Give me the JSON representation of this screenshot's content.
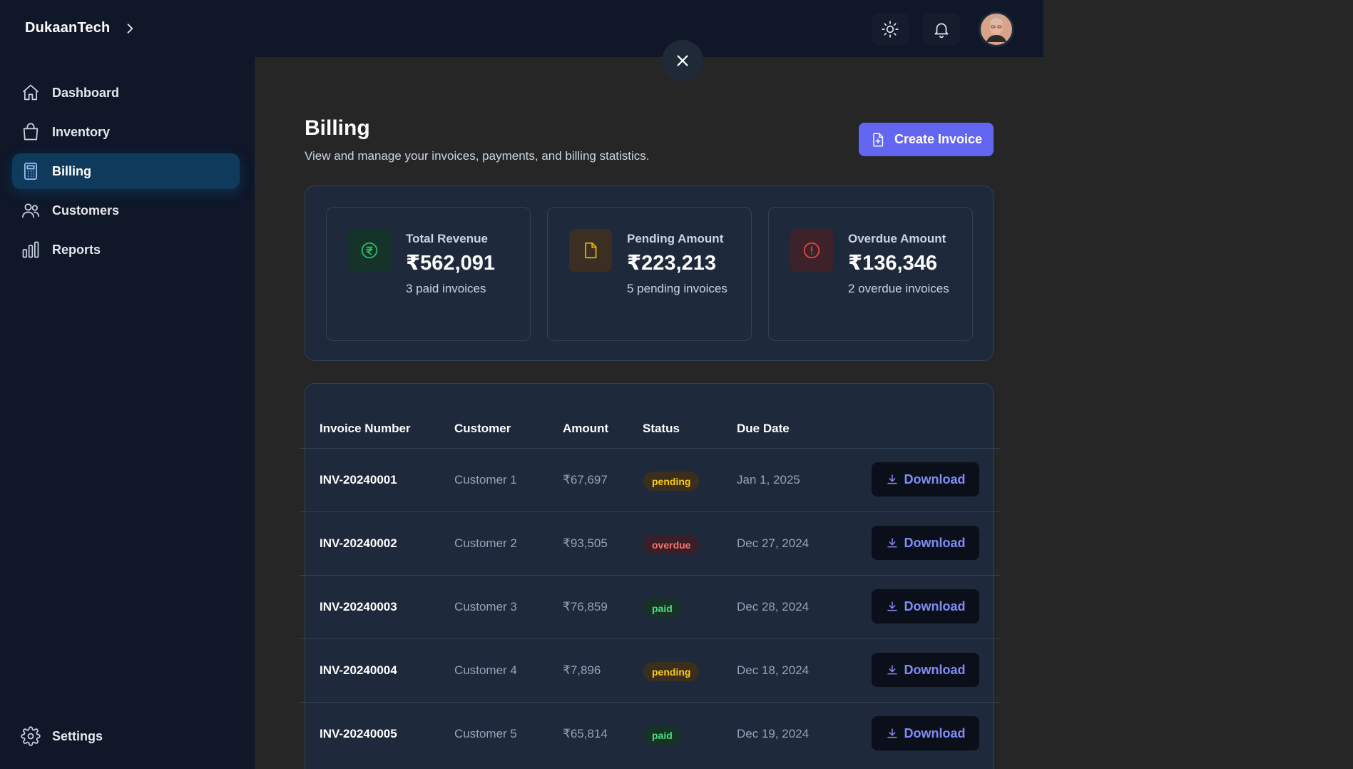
{
  "app": {
    "brand": "DukaanTech"
  },
  "sidebar": {
    "items": [
      {
        "label": "Dashboard",
        "icon": "home-icon"
      },
      {
        "label": "Inventory",
        "icon": "shopping-bag-icon"
      },
      {
        "label": "Billing",
        "icon": "calculator-icon",
        "active": true
      },
      {
        "label": "Customers",
        "icon": "users-icon"
      },
      {
        "label": "Reports",
        "icon": "bar-chart-icon"
      }
    ],
    "settings_label": "Settings"
  },
  "header": {
    "title": "Billing",
    "subtitle": "View and manage your invoices, payments, and billing statistics.",
    "create_label": "Create Invoice"
  },
  "stats": [
    {
      "label": "Total Revenue",
      "value": "₹562,091",
      "sub": "3 paid invoices",
      "icon": "rupee-circle-icon",
      "color": "#22c55e"
    },
    {
      "label": "Pending Amount",
      "value": "₹223,213",
      "sub": "5 pending invoices",
      "icon": "document-icon",
      "color": "#eab308"
    },
    {
      "label": "Overdue Amount",
      "value": "₹136,346",
      "sub": "2 overdue invoices",
      "icon": "alert-circle-icon",
      "color": "#ef4444"
    }
  ],
  "table": {
    "columns": [
      "Invoice Number",
      "Customer",
      "Amount",
      "Status",
      "Due Date"
    ],
    "download_label": "Download",
    "rows": [
      {
        "invoice": "INV-20240001",
        "customer": "Customer 1",
        "amount": "₹67,697",
        "status": "pending",
        "due": "Jan 1, 2025"
      },
      {
        "invoice": "INV-20240002",
        "customer": "Customer 2",
        "amount": "₹93,505",
        "status": "overdue",
        "due": "Dec 27, 2024"
      },
      {
        "invoice": "INV-20240003",
        "customer": "Customer 3",
        "amount": "₹76,859",
        "status": "paid",
        "due": "Dec 28, 2024"
      },
      {
        "invoice": "INV-20240004",
        "customer": "Customer 4",
        "amount": "₹7,896",
        "status": "pending",
        "due": "Dec 18, 2024"
      },
      {
        "invoice": "INV-20240005",
        "customer": "Customer 5",
        "amount": "₹65,814",
        "status": "paid",
        "due": "Dec 19, 2024"
      }
    ]
  },
  "colors": {
    "accent": "#6366f1",
    "sidebar_bg": "#0f1729",
    "active_nav": "#0f3a5c"
  }
}
